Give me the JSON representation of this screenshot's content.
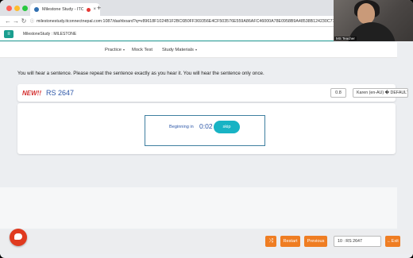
{
  "browser": {
    "tab_title": "Milestone Study - ITCN",
    "tab_close": "×",
    "new_tab": "+",
    "back": "←",
    "forward": "→",
    "reload": "↻",
    "url": "milestonestudy.itconnectnepal.com:1087/dashboard?q=v89618F1024B1F2BC6B0FF369356E4CF503576E559A86AFC46000A78E0958B9A48538B124230C772"
  },
  "app": {
    "menu_icon": "≡",
    "brand": "MilestoneStudy : MILESTONE"
  },
  "video": {
    "label": "MS Teacher"
  },
  "nav": {
    "items": [
      {
        "label": "Practice",
        "caret": "▾"
      },
      {
        "label": "Mock Test",
        "caret": ""
      },
      {
        "label": "Study Materials",
        "caret": "▾"
      }
    ]
  },
  "instruction": "You will hear a sentence. Please repeat the sentence exactly as you hear it. You will hear the sentence only once.",
  "question": {
    "badge": "NEW!!",
    "code": "RS 2647",
    "speed": "0.8",
    "voice": "Karen (en-AU) � DEFAULT"
  },
  "recorder": {
    "label": "Beginning in",
    "timer": "0:02",
    "skip": "skip"
  },
  "footer": {
    "shuffle_icon": "⤨",
    "restart": "Restart",
    "previous": "Previous",
    "question_select": "10 : RS 2647",
    "exit": "Exit",
    "exit_icon": "←"
  },
  "colors": {
    "accent": "#1a9e8f",
    "orange": "#ef7d22",
    "blue": "#2d57a8",
    "red": "#d32f2f"
  }
}
